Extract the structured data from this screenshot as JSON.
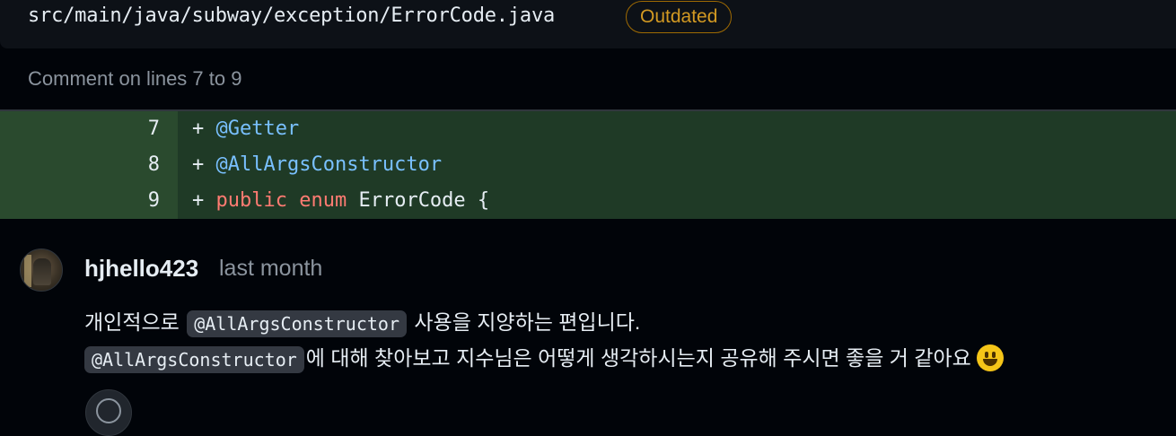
{
  "file": {
    "path": "src/main/java/subway/exception/ErrorCode.java",
    "status_badge": "Outdated"
  },
  "review": {
    "comment_on": "Comment on lines 7 to 9"
  },
  "diff": {
    "lines": [
      {
        "number": "7",
        "marker": "+",
        "tokens": [
          {
            "text": "@Getter",
            "kind": "annotation"
          }
        ]
      },
      {
        "number": "8",
        "marker": "+",
        "tokens": [
          {
            "text": "@AllArgsConstructor",
            "kind": "annotation"
          }
        ]
      },
      {
        "number": "9",
        "marker": "+",
        "tokens": [
          {
            "text": "public",
            "kind": "keyword"
          },
          {
            "text": " ",
            "kind": "plain"
          },
          {
            "text": "enum",
            "kind": "keyword"
          },
          {
            "text": " ErrorCode {",
            "kind": "plain"
          }
        ]
      }
    ]
  },
  "comment": {
    "author": "hjhello423",
    "time": "last month",
    "line1_prefix": "개인적으로 ",
    "line1_code": "@AllArgsConstructor",
    "line1_suffix": " 사용을 지양하는 편입니다.",
    "line2_code": "@AllArgsConstructor",
    "line2_text": "에 대해 찾아보고 지수님은 어떻게 생각하시는지 공유해 주시면 좋을 거 같아요",
    "emoji": "grinning-face-emoji"
  },
  "colors": {
    "badge": "#d29922",
    "diff_added_gutter": "#2a4a2e",
    "diff_added_code": "#1f3a26",
    "annotation": "#79c0ff",
    "keyword": "#ff7b72"
  }
}
